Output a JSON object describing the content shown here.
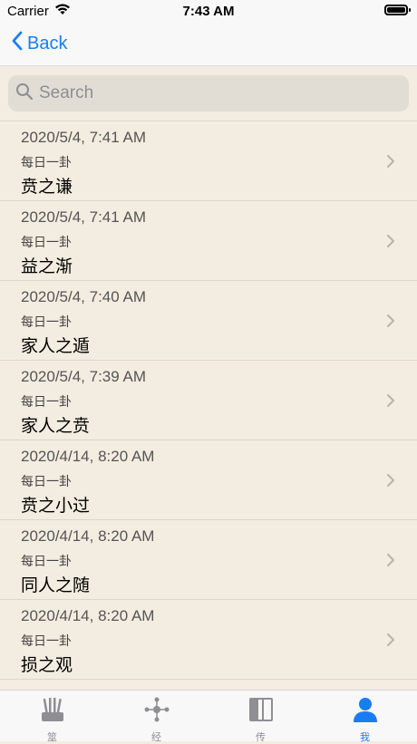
{
  "status": {
    "carrier": "Carrier",
    "time": "7:43 AM"
  },
  "nav": {
    "back_label": "Back"
  },
  "search": {
    "placeholder": "Search"
  },
  "items": [
    {
      "time": "2020/5/4, 7:41 AM",
      "subtitle": "每日一卦",
      "title": "贲之谦"
    },
    {
      "time": "2020/5/4, 7:41 AM",
      "subtitle": "每日一卦",
      "title": "益之渐"
    },
    {
      "time": "2020/5/4, 7:40 AM",
      "subtitle": "每日一卦",
      "title": "家人之遁"
    },
    {
      "time": "2020/5/4, 7:39 AM",
      "subtitle": "每日一卦",
      "title": "家人之贲"
    },
    {
      "time": "2020/4/14, 8:20 AM",
      "subtitle": "每日一卦",
      "title": "贲之小过"
    },
    {
      "time": "2020/4/14, 8:20 AM",
      "subtitle": "每日一卦",
      "title": "同人之随"
    },
    {
      "time": "2020/4/14, 8:20 AM",
      "subtitle": "每日一卦",
      "title": "损之观"
    }
  ],
  "tabs": [
    {
      "label": "筮",
      "icon": "sticks-icon"
    },
    {
      "label": "经",
      "icon": "network-icon"
    },
    {
      "label": "传",
      "icon": "book-icon"
    },
    {
      "label": "我",
      "icon": "person-icon",
      "active": true
    }
  ],
  "colors": {
    "accent": "#1a7cf4",
    "background": "#f3ece0"
  }
}
